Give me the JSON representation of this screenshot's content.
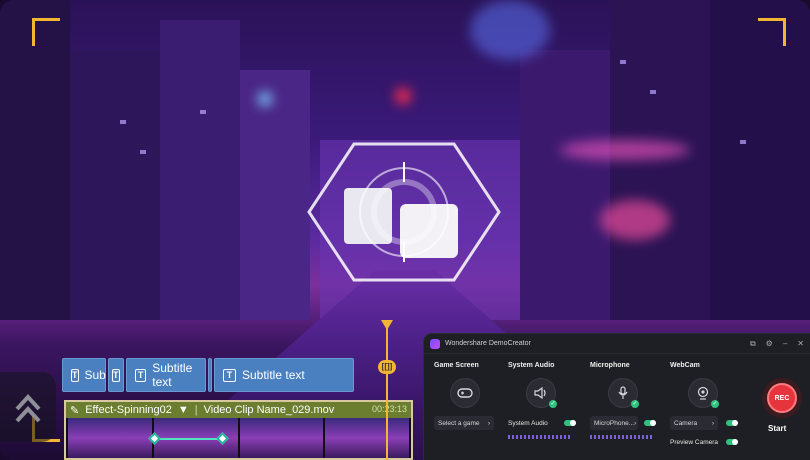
{
  "timeline": {
    "subtitle_clips": [
      {
        "label": "Sub"
      },
      {
        "label": ""
      },
      {
        "label": "Subtitle text"
      },
      {
        "label": ""
      },
      {
        "label": "Subtitle text"
      }
    ],
    "video_clip": {
      "effect_name": "Effect-Spinning02",
      "clip_name": "Video Clip Name_029.mov",
      "duration": "00:23:13"
    },
    "playhead_label": "[[]]"
  },
  "panel": {
    "app_title": "Wondershare DemoCreator",
    "window_controls": [
      "⧉",
      "⚙",
      "–",
      "✕"
    ],
    "columns": {
      "game_screen": {
        "title": "Game Screen",
        "select": "Select a game"
      },
      "system_audio": {
        "title": "System Audio",
        "toggle_label": "System Audio"
      },
      "microphone": {
        "title": "Microphone",
        "select": "MicroPhone..."
      },
      "webcam": {
        "title": "WebCam",
        "select": "Camera",
        "preview_label": "Preview Camera"
      }
    },
    "rec_label": "REC",
    "start_label": "Start"
  },
  "colors": {
    "accent": "#f2b632",
    "rec": "#e5343b",
    "toggle_on": "#2ec27e"
  }
}
